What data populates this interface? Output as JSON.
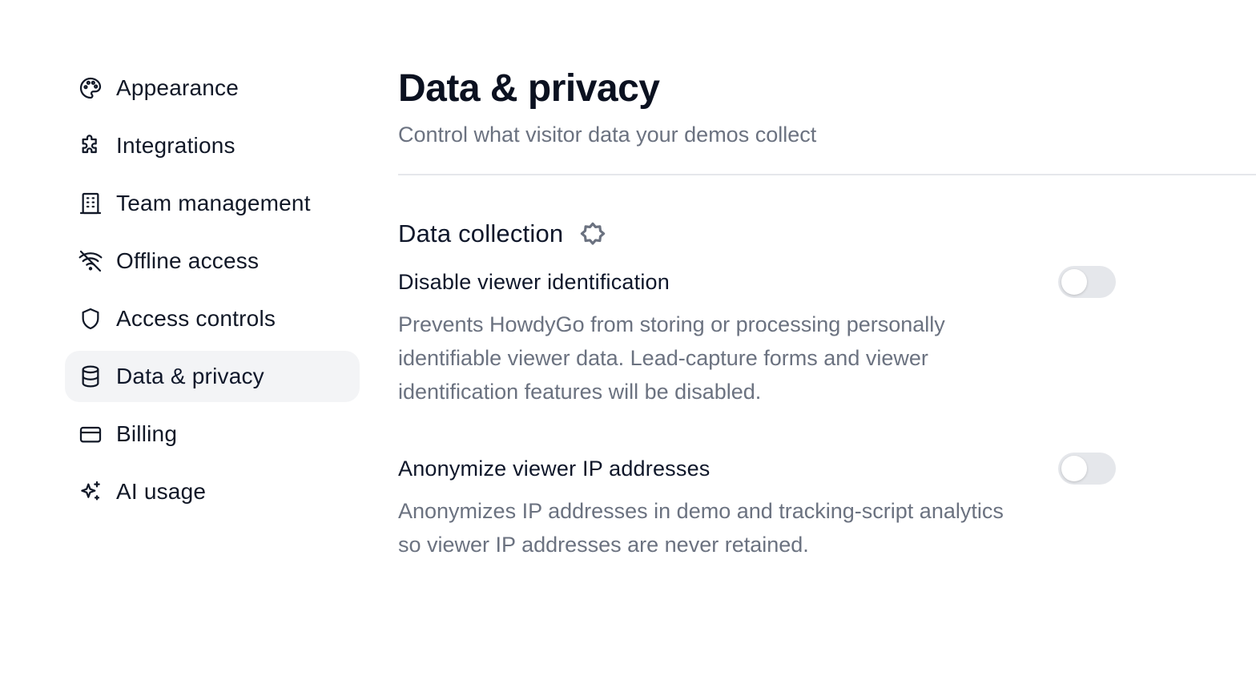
{
  "sidebar": {
    "items": [
      {
        "label": "Appearance",
        "icon": "palette-icon"
      },
      {
        "label": "Integrations",
        "icon": "puzzle-icon"
      },
      {
        "label": "Team management",
        "icon": "building-icon"
      },
      {
        "label": "Offline access",
        "icon": "wifi-off-icon"
      },
      {
        "label": "Access controls",
        "icon": "shield-icon"
      },
      {
        "label": "Data & privacy",
        "icon": "database-icon",
        "active": true
      },
      {
        "label": "Billing",
        "icon": "credit-card-icon"
      },
      {
        "label": "AI usage",
        "icon": "sparkles-icon"
      }
    ]
  },
  "main": {
    "title": "Data & privacy",
    "subtitle": "Control what visitor data your demos collect",
    "section": {
      "title": "Data collection",
      "icon": "badge-icon",
      "settings": [
        {
          "title": "Disable viewer identification",
          "description": "Prevents HowdyGo from storing or processing personally identifiable viewer data. Lead-capture forms and viewer identification features will be disabled.",
          "enabled": false
        },
        {
          "title": "Anonymize viewer IP addresses",
          "description": "Anonymizes IP addresses in demo and tracking-script analytics so viewer IP addresses are never retained.",
          "enabled": false
        }
      ]
    }
  },
  "colors": {
    "active_bg": "#f3f4f6",
    "muted_text": "#6b7280",
    "toggle_off": "#e5e7eb"
  }
}
